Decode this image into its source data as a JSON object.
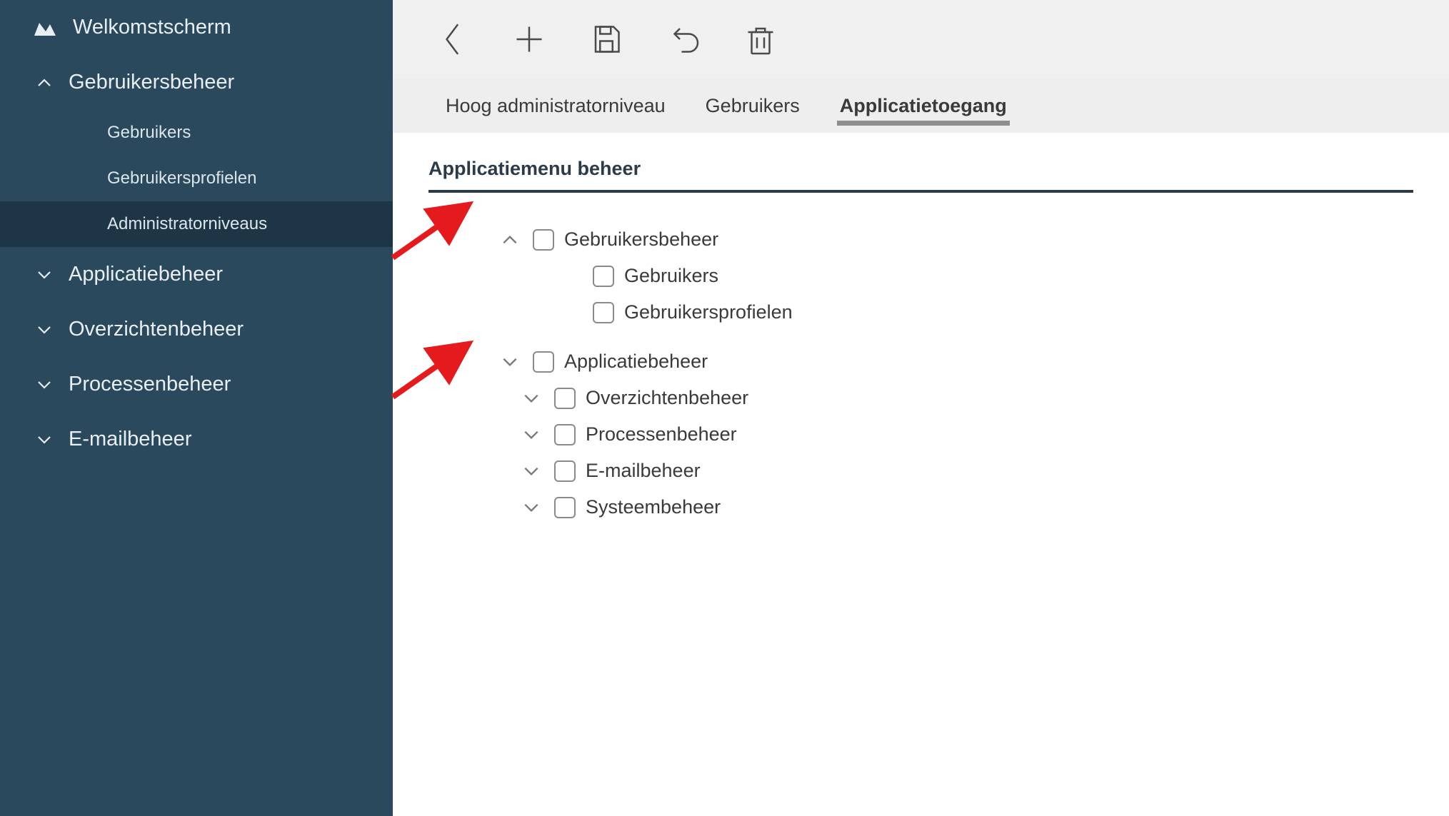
{
  "sidebar": {
    "welcome_label": "Welkomstscherm",
    "items": [
      {
        "label": "Gebruikersbeheer",
        "expanded": true,
        "children": [
          {
            "label": "Gebruikers"
          },
          {
            "label": "Gebruikersprofielen"
          },
          {
            "label": "Administratorniveaus",
            "active": true
          }
        ]
      },
      {
        "label": "Applicatiebeheer",
        "expanded": false
      },
      {
        "label": "Overzichtenbeheer",
        "expanded": false
      },
      {
        "label": "Processenbeheer",
        "expanded": false
      },
      {
        "label": "E-mailbeheer",
        "expanded": false
      }
    ]
  },
  "toolbar": {
    "back": "Back",
    "add": "Add",
    "save": "Save",
    "undo": "Undo",
    "delete": "Delete"
  },
  "tabs": [
    {
      "label": "Hoog administratorniveau",
      "active": false
    },
    {
      "label": "Gebruikers",
      "active": false
    },
    {
      "label": "Applicatietoegang",
      "active": true
    }
  ],
  "section_title": "Applicatiemenu beheer",
  "tree": [
    {
      "label": "Gebruikersbeheer",
      "expanded": true,
      "checked": false,
      "children": [
        {
          "label": "Gebruikers",
          "checked": false
        },
        {
          "label": "Gebruikersprofielen",
          "checked": false
        }
      ]
    },
    {
      "label": "Applicatiebeheer",
      "expanded": false,
      "checked": false
    },
    {
      "label": "Overzichtenbeheer",
      "expanded": false,
      "checked": false
    },
    {
      "label": "Processenbeheer",
      "expanded": false,
      "checked": false
    },
    {
      "label": "E-mailbeheer",
      "expanded": false,
      "checked": false
    },
    {
      "label": "Systeembeheer",
      "expanded": false,
      "checked": false
    }
  ]
}
